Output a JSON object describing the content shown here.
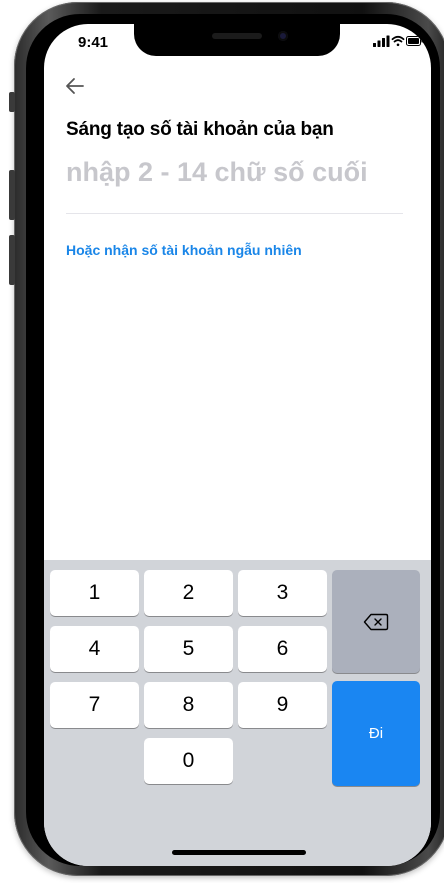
{
  "status_bar": {
    "time": "9:41"
  },
  "header": {
    "title": "Sáng tạo số tài khoản của bạn"
  },
  "input": {
    "placeholder": "nhập 2 - 14 chữ số cuối",
    "value": ""
  },
  "random_link": "Hoặc nhận số tài khoản ngẫu nhiên",
  "keypad": {
    "keys": [
      "1",
      "2",
      "3",
      "4",
      "5",
      "6",
      "7",
      "8",
      "9",
      "0"
    ],
    "go_label": "Đi"
  },
  "colors": {
    "accent": "#1a86f2",
    "link": "#1a86e8",
    "keyboard_bg": "#d1d4d9"
  }
}
